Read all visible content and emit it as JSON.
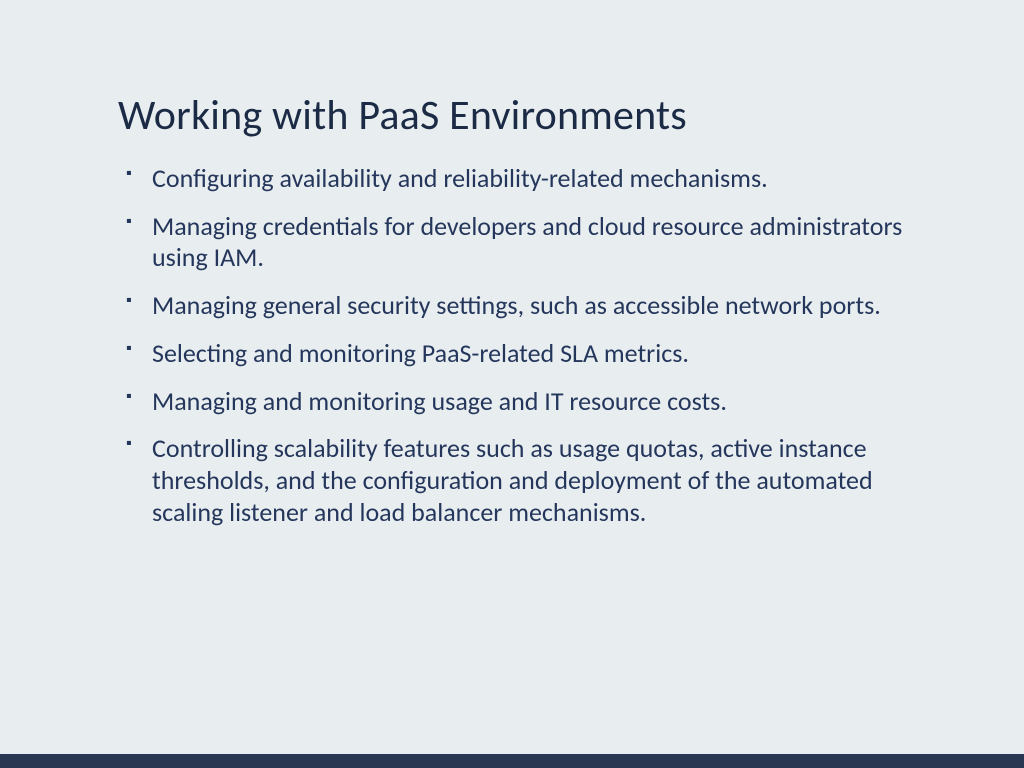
{
  "slide": {
    "title": "Working with PaaS Environments",
    "bullets": [
      "Configuring availability and reliability-related mechanisms.",
      "Managing credentials for developers and cloud resource administrators using IAM.",
      "Managing general security settings, such as accessible network ports.",
      "Selecting and monitoring PaaS-related SLA metrics.",
      "Managing and monitoring usage and IT resource costs.",
      "Controlling scalability features such as usage quotas, active instance thresholds, and the configuration and deployment of the automated scaling listener and load balancer mechanisms."
    ]
  }
}
